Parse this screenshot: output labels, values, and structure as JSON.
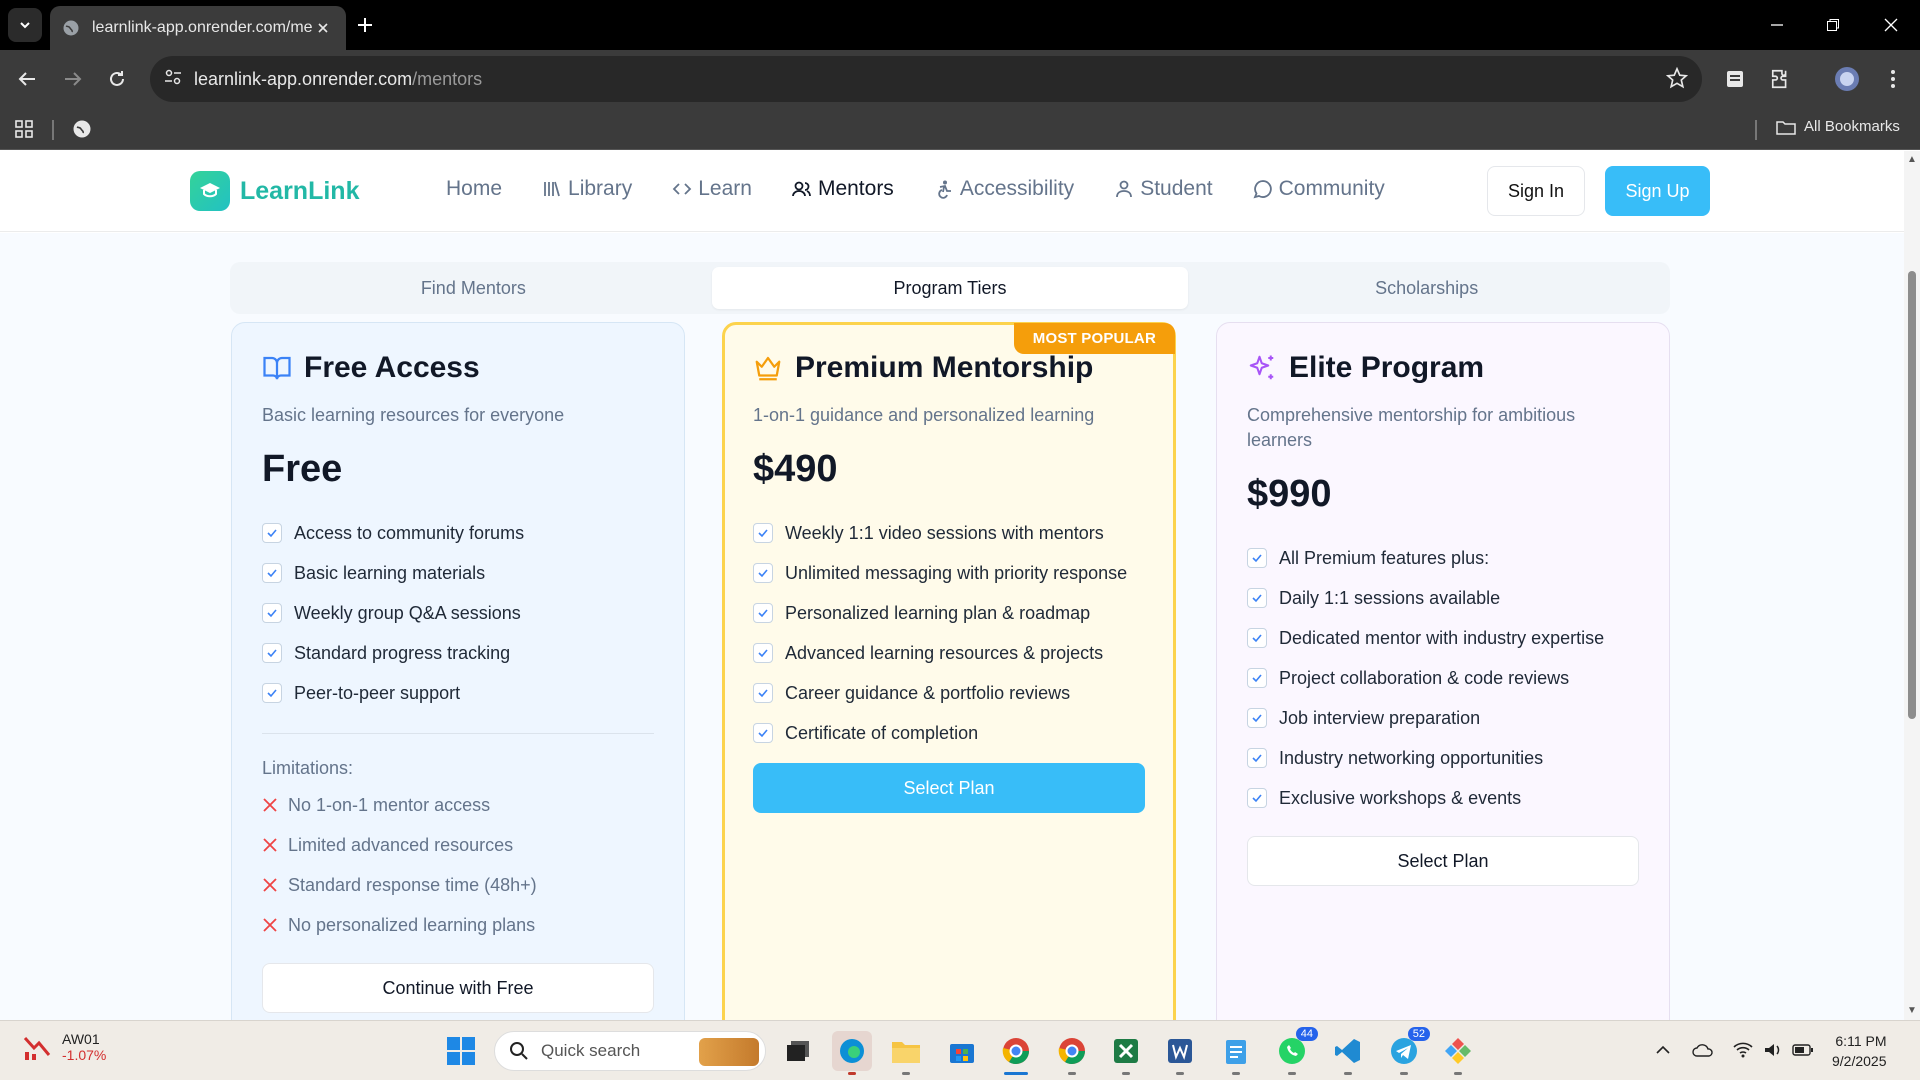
{
  "browser": {
    "tab_title": "learnlink-app.onrender.com/me",
    "url_host": "learnlink-app.onrender.com",
    "url_path": "/mentors",
    "all_bookmarks": "All Bookmarks"
  },
  "header": {
    "logo_text": "LearnLink",
    "nav": [
      {
        "label": "Home",
        "icon": "none"
      },
      {
        "label": "Library",
        "icon": "library-icon"
      },
      {
        "label": "Learn",
        "icon": "code-icon"
      },
      {
        "label": "Mentors",
        "icon": "users-icon",
        "active": true
      },
      {
        "label": "Accessibility",
        "icon": "accessibility-icon"
      },
      {
        "label": "Student",
        "icon": "user-icon"
      },
      {
        "label": "Community",
        "icon": "chat-icon"
      }
    ],
    "sign_in": "Sign In",
    "sign_up": "Sign Up"
  },
  "tabs": [
    "Find Mentors",
    "Program Tiers",
    "Scholarships"
  ],
  "active_tab": "Program Tiers",
  "tiers": {
    "free": {
      "title": "Free Access",
      "description": "Basic learning resources for everyone",
      "price": "Free",
      "features": [
        "Access to community forums",
        "Basic learning materials",
        "Weekly group Q&A sessions",
        "Standard progress tracking",
        "Peer-to-peer support"
      ],
      "limitations_title": "Limitations:",
      "limitations": [
        "No 1-on-1 mentor access",
        "Limited advanced resources",
        "Standard response time (48h+)",
        "No personalized learning plans"
      ],
      "button": "Continue with Free"
    },
    "premium": {
      "badge": "MOST POPULAR",
      "title": "Premium Mentorship",
      "description": "1-on-1 guidance and personalized learning",
      "price": "$490",
      "features": [
        "Weekly 1:1 video sessions with mentors",
        "Unlimited messaging with priority response",
        "Personalized learning plan & roadmap",
        "Advanced learning resources & projects",
        "Career guidance & portfolio reviews",
        "Certificate of completion"
      ],
      "button": "Select Plan"
    },
    "elite": {
      "title": "Elite Program",
      "description": "Comprehensive mentorship for ambitious learners",
      "price": "$990",
      "features": [
        "All Premium features plus:",
        "Daily 1:1 sessions available",
        "Dedicated mentor with industry expertise",
        "Project collaboration & code reviews",
        "Job interview preparation",
        "Industry networking opportunities",
        "Exclusive workshops & events"
      ],
      "button": "Select Plan"
    }
  },
  "taskbar": {
    "stock_name": "AW01",
    "stock_change": "-1.07%",
    "search_placeholder": "Quick search",
    "whatsapp_badge": "44",
    "telegram_badge": "52",
    "time": "6:11 PM",
    "date": "9/2/2025"
  },
  "colors": {
    "brand": "#22b8a6",
    "primary_button": "#38bdf8",
    "popular_badge": "#f59e0b",
    "premium_border": "#fcd34d"
  }
}
